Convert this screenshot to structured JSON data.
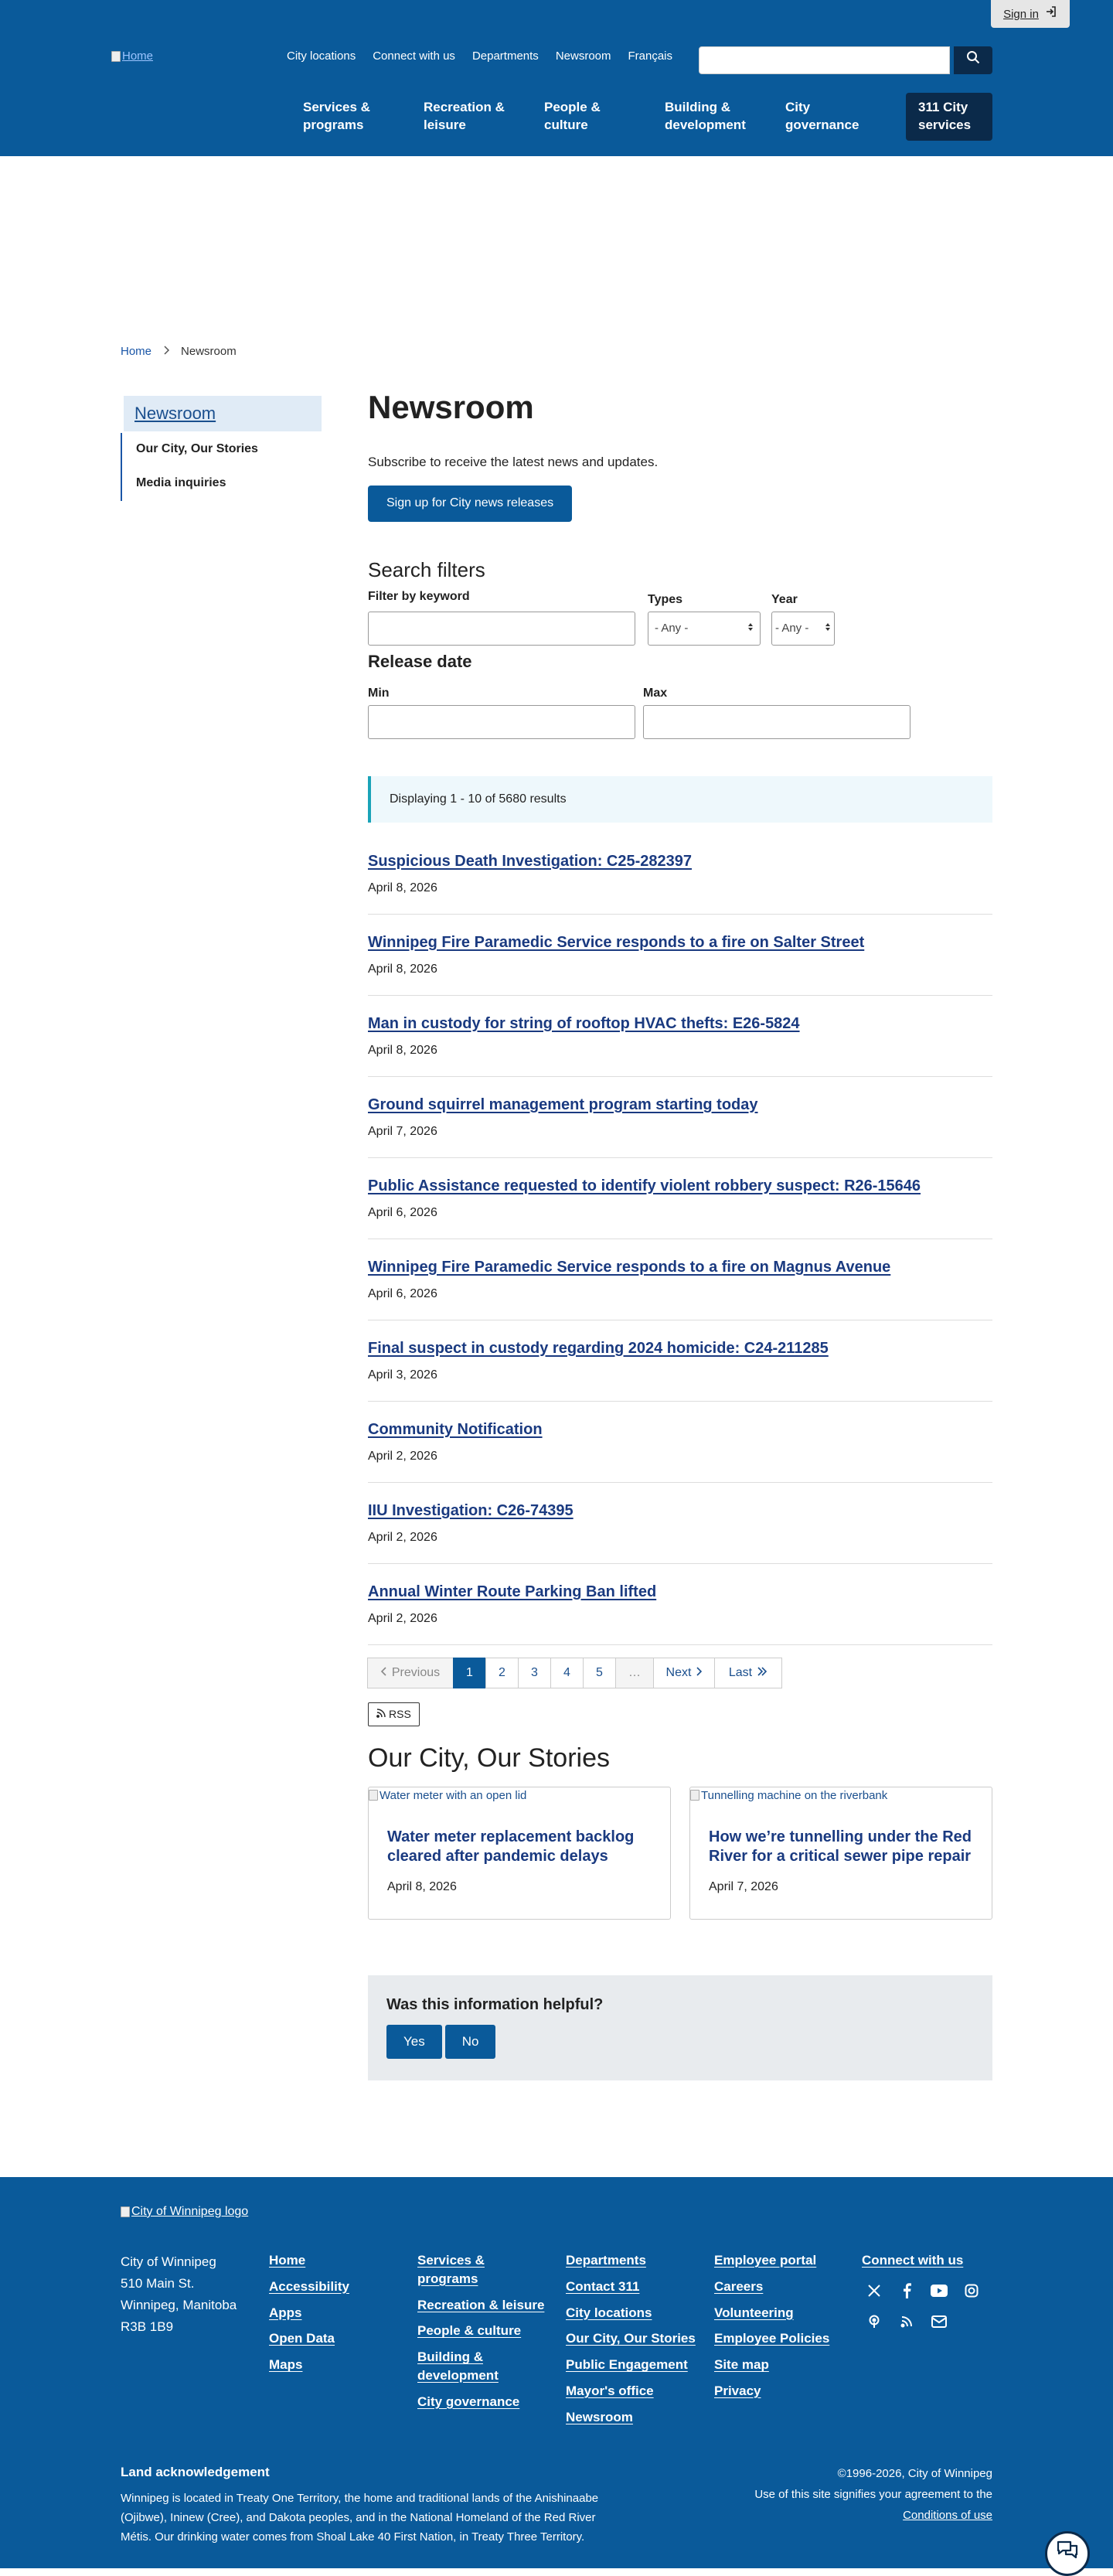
{
  "header": {
    "sign_in": "Sign in",
    "logo_alt": "Home",
    "utility_nav": [
      "City locations",
      "Connect with us",
      "Departments",
      "Newsroom",
      "Français"
    ],
    "search_placeholder": "",
    "main_nav": [
      "Services & programs",
      "Recreation & leisure",
      "People & culture",
      "Building & development",
      "City governance"
    ],
    "nav_311": "311 City services"
  },
  "breadcrumb": {
    "home": "Home",
    "current": "Newsroom"
  },
  "sidebar": {
    "heading": "Newsroom",
    "items": [
      "Our City, Our Stories",
      "Media inquiries"
    ]
  },
  "main": {
    "title": "Newsroom",
    "lead": "Subscribe to receive the latest news and updates.",
    "signup_button": "Sign up for City news releases",
    "filters_title": "Search filters",
    "keyword_label": "Filter by keyword",
    "types_label": "Types",
    "types_value": "- Any -",
    "year_label": "Year",
    "year_value": "- Any -",
    "release_title": "Release date",
    "min_label": "Min",
    "max_label": "Max",
    "results_text": "Displaying 1 - 10 of 5680 results"
  },
  "news": [
    {
      "title": "Suspicious Death Investigation: C25-282397",
      "date": "April 8, 2026"
    },
    {
      "title": "Winnipeg Fire Paramedic Service responds to a fire on Salter Street",
      "date": "April 8, 2026"
    },
    {
      "title": "Man in custody for string of rooftop HVAC thefts: E26-5824",
      "date": "April 8, 2026"
    },
    {
      "title": "Ground squirrel management program starting today",
      "date": "April 7, 2026"
    },
    {
      "title": "Public Assistance requested to identify violent robbery suspect: R26-15646",
      "date": "April 6, 2026"
    },
    {
      "title": "Winnipeg Fire Paramedic Service responds to a fire on Magnus Avenue",
      "date": "April 6, 2026"
    },
    {
      "title": "Final suspect in custody regarding 2024 homicide: C24-211285",
      "date": "April 3, 2026"
    },
    {
      "title": "Community Notification",
      "date": "April 2, 2026"
    },
    {
      "title": "IIU Investigation: C26-74395",
      "date": "April 2, 2026"
    },
    {
      "title": "Annual Winter Route Parking Ban lifted",
      "date": "April 2, 2026"
    }
  ],
  "pager": {
    "previous": "Previous",
    "pages": [
      "1",
      "2",
      "3",
      "4",
      "5"
    ],
    "ellipsis": "…",
    "next": "Next",
    "last": "Last",
    "current": 1
  },
  "rss": "RSS",
  "stories": {
    "title": "Our City, Our Stories",
    "cards": [
      {
        "img_alt": "Water meter with an open lid",
        "title": "Water meter replacement backlog cleared after pandemic delays",
        "date": "April 8, 2026"
      },
      {
        "img_alt": "Tunnelling machine on the riverbank",
        "title": "How we’re tunnelling under the Red River for a critical sewer pipe repair",
        "date": "April 7, 2026"
      }
    ]
  },
  "helpful": {
    "title": "Was this information helpful?",
    "yes": "Yes",
    "no": "No"
  },
  "footer": {
    "logo_alt": "City of Winnipeg logo",
    "address": [
      "City of Winnipeg",
      "510 Main St.",
      "Winnipeg, Manitoba",
      "R3B 1B9"
    ],
    "col1": [
      "Home",
      "Accessibility",
      "Apps",
      "Open Data",
      "Maps"
    ],
    "col2": [
      "Services & programs",
      "Recreation & leisure",
      "People & culture",
      "Building & development",
      "City governance"
    ],
    "col3": [
      "Departments",
      "Contact 311",
      "City locations",
      "Our City, Our Stories",
      "Public Engagement",
      "Mayor's office",
      "Newsroom"
    ],
    "col4": [
      "Employee portal",
      "Careers",
      "Volunteering",
      "Employee Policies",
      "Site map",
      "Privacy"
    ],
    "connect": "Connect with us",
    "social_icons": [
      "x-icon",
      "facebook-icon",
      "youtube-icon",
      "instagram-icon",
      "podcast-icon",
      "rss-icon",
      "email-icon"
    ],
    "land_title": "Land acknowledgement",
    "land_text": "Winnipeg is located in Treaty One Territory, the home and traditional lands of the Anishinaabe (Ojibwe), Ininew (Cree), and Dakota peoples, and in the National Homeland of the Red River Métis. Our drinking water comes from Shoal Lake 40 First Nation, in Treaty Three Territory.",
    "copyright": "©1996-2026, City of Winnipeg",
    "terms_prefix": "Use of this site signifies your agreement to the",
    "terms_link": "Conditions of use"
  },
  "colors": {
    "brand_blue": "#0a5a9a",
    "dark_navy": "#0b2a4a",
    "link_navy": "#1a3a80",
    "info_teal": "#1aa3b8"
  }
}
